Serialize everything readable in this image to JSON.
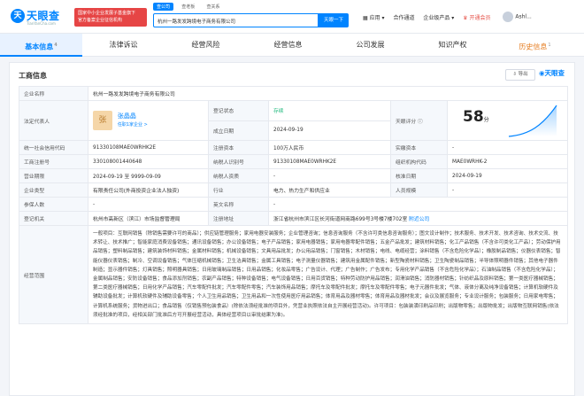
{
  "header": {
    "logo_icon": "天",
    "logo_text": "天眼查",
    "logo_sub": "TianYanCha.com",
    "gov_badge_line1": "国家中小企业发展子基金旗下",
    "gov_badge_line2": "官方备案企业征信机构",
    "search_tabs": [
      "查公司",
      "查老板",
      "查关系"
    ],
    "search_value": "杭州一路发发跨境电子商务有限公司",
    "search_button": "天眼一下",
    "nav": [
      "应用",
      "合作通道",
      "企业级产品",
      "开通会员",
      "Ashl..."
    ]
  },
  "tabs": [
    {
      "label": "基本信息",
      "count": "4"
    },
    {
      "label": "法律诉讼",
      "count": ""
    },
    {
      "label": "经营风险",
      "count": ""
    },
    {
      "label": "经营信息",
      "count": ""
    },
    {
      "label": "公司发展",
      "count": ""
    },
    {
      "label": "知识产权",
      "count": ""
    },
    {
      "label": "历史信息",
      "count": "1"
    }
  ],
  "card": {
    "title": "工商信息",
    "export": "导出",
    "watermark": "天眼查"
  },
  "info": {
    "company_name_label": "企业名称",
    "company_name": "杭州一路发发跨境电子商务有限公司",
    "rep_label": "法定代表人",
    "rep_avatar": "张",
    "rep_name": "张晶晶",
    "rep_sub": "任职1家企业 >",
    "reg_status_label": "登记状态",
    "reg_status": "存续",
    "est_date_label": "成立日期",
    "est_date": "2024-09-19",
    "score_label": "天眼评分",
    "score": "58",
    "score_unit": "分",
    "credit_code_label": "统一社会信用代码",
    "credit_code": "91330108MAE0WRHK2E",
    "reg_capital_label": "注册资本",
    "reg_capital": "100万人民币",
    "paid_capital_label": "实缴资本",
    "paid_capital": "-",
    "reg_no_label": "工商注册号",
    "reg_no": "330108001440648",
    "tax_no_label": "纳税人识别号",
    "tax_no": "91330108MAE0WRHK2E",
    "org_code_label": "组织机构代码",
    "org_code": "MAE0WRHK-2",
    "term_label": "营业期限",
    "term": "2024-09-19 至 9999-09-09",
    "taxpayer_label": "纳税人资质",
    "taxpayer": "-",
    "approve_label": "核准日期",
    "approve": "2024-09-19",
    "type_label": "企业类型",
    "type": "有限责任公司(外商投资企业法人独资)",
    "industry_label": "行业",
    "industry": "电力、热力生产和供应业",
    "staff_label": "人员规模",
    "staff": "-",
    "insured_label": "参保人数",
    "insured": "-",
    "en_name_label": "英文名称",
    "en_name": "-",
    "authority_label": "登记机关",
    "authority": "杭州市高新区（滨江）市场监督管理局",
    "address_label": "注册地址",
    "address": "浙江省杭州市滨江区长河街道网商路699号3号楼7楼702室",
    "address_link": "附近公司",
    "scope_label": "经营范围",
    "scope": "一般项目：互联网销售（除销售需要许可的商品）；供应链管理服务；家用电器安装服务；企业管理咨询；信息咨询服务（不含许可类信息咨询服务）；图文设计制作；技术服务、技术开发、技术咨询、技术交流、技术转让、技术推广；智能家庭消费设备销售；通讯设备销售；办公设备销售；电子产品销售；家用电器销售；家用电器零配件销售；五金产品批发；建筑材料销售；化工产品销售（不含许可类化工产品）；劳动保护用品销售；塑料制品销售；建筑装饰材料销售；金属材料销售；机械设备销售；文具用品批发；办公用品销售；门窗销售；木材销售；电线、电缆经营；涂料销售（不含危险化学品）；橡胶制品销售；仪器仪表销售；智能仪器仪表销售；制冷、空调设备销售；气体压缩机械销售；卫生洁具销售；金属工具销售；电子测量仪器销售；建筑用金属配件销售；新型陶瓷材料销售；卫生陶瓷制品销售；半导体照明器件销售；其他电子器件制造；显示器件销售；灯具销售；照明器具销售；日用玻璃制品销售；日用品销售；化妆品零售；广告设计、代理；广告制作；广告发布；专用化学产品销售（不含危险化学品）；石油制品销售（不含危险化学品）；金属制品销售；安防设备销售；食品添加剂销售；农副产品销售；特种设备销售；电气设备销售；日用百货销售；特种劳动防护用品销售；润滑油销售；消防器材销售；针纺织品及原料销售；第一类医疗器械销售；第二类医疗器械销售；日用化学产品销售；汽车零配件批发；汽车零配件零售；汽车装饰用品销售；摩托车及零配件批发；摩托车及零配件零售；电子元器件批发；气体、液体分离及纯净设备销售；计算机软硬件及辅助设备批发；计算机软硬件及辅助设备零售；个人卫生用品销售；卫生用品和一次性使用医疗用品销售；体育用品及器材零售；体育用品及器材批发；会议及展览服务；专业设计服务；包装服务；日用家电零售；计算机系统服务；货物进出口；食品销售（仅销售预包装食品）(除依法须经批准的项目外，凭营业执照依法自主开展经营活动)。许可项目：包装装潢印刷品印刷；出版物零售；出版物批发；出版物互联网销售(依法须经批准的项目，经相关部门批准后方可开展经营活动，具体经营项目以审批结果为准)。"
  },
  "colors": {
    "brand": "#0084ff",
    "ok": "#1db87c",
    "vip": "#e6544b",
    "history": "#e67e22"
  }
}
